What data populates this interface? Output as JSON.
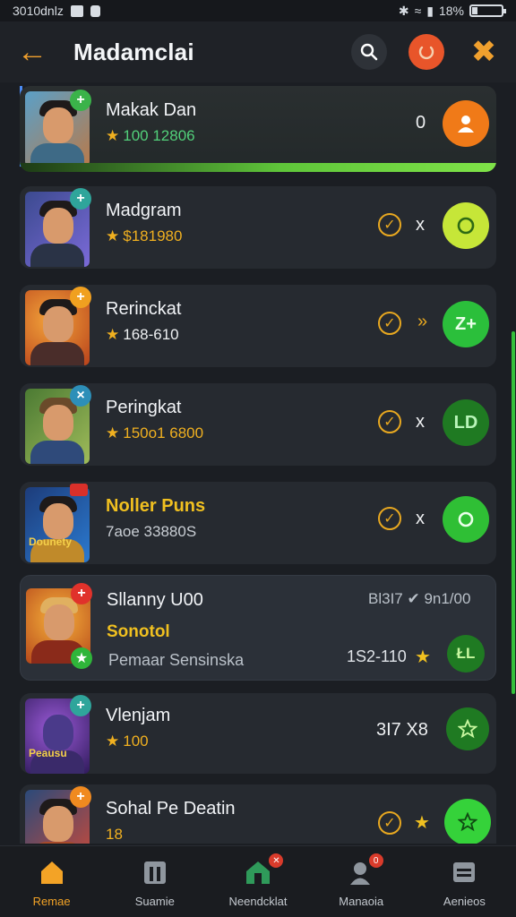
{
  "status_bar": {
    "carrier": "3010dnlz",
    "battery": "18%",
    "battery_level": 0.18
  },
  "header": {
    "title": "Madamclai",
    "back_icon": "arrow-left-icon",
    "search_icon": "search-icon",
    "power_icon": "power-icon",
    "close_icon": "close-icon"
  },
  "colors": {
    "accent": "#f0a02e",
    "green": "#35c03b",
    "background": "#1b1e23",
    "card": "#262a30"
  },
  "players": [
    {
      "name": "Makak Dan",
      "score": "100 12806",
      "trailing": "0",
      "action_icon": "user-icon"
    },
    {
      "name": "Madgram",
      "score": "$181980",
      "trailing": "x",
      "action_icon": "refresh-icon"
    },
    {
      "name": "Rerinckat",
      "score": "168-610",
      "trailing": "»",
      "action_label": "Z+"
    },
    {
      "name": "Peringkat",
      "score": "150o1 6800",
      "trailing": "x",
      "action_label": "LD"
    },
    {
      "name": "Noller Puns",
      "score": "7aoe 33880S",
      "trailing": "x",
      "action_icon": "camera-icon",
      "avatar_caption": "Dounety"
    },
    {
      "name": "Sllanny U00",
      "subtitle": "Sonotol",
      "detail": "Pemaar Sensinska",
      "stat_right": "Bl3I7 ✔ 9n1/00",
      "score": "1S2-110",
      "action_label": "ŁL"
    },
    {
      "name": "Vlenjam",
      "score": "100",
      "trailing": "3I7 X8",
      "action_icon": "star-icon",
      "avatar_caption": "Peausu"
    },
    {
      "name": "Sohal Pe Deatin",
      "score": "18",
      "action_icon": "star-icon"
    }
  ],
  "nav": [
    {
      "label": "Remae",
      "icon": "home-icon"
    },
    {
      "label": "Suamie",
      "icon": "building-icon"
    },
    {
      "label": "Neendcklat",
      "icon": "store-icon"
    },
    {
      "label": "Manaoia",
      "icon": "profile-icon"
    },
    {
      "label": "Aenieos",
      "icon": "menu-icon"
    }
  ]
}
